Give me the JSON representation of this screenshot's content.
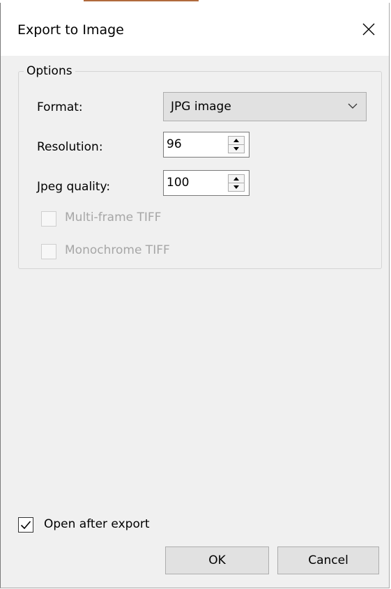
{
  "window": {
    "title": "Export to Image"
  },
  "options": {
    "group_label": "Options",
    "format": {
      "label": "Format:",
      "value": "JPG image"
    },
    "resolution": {
      "label": "Resolution:",
      "value": "96"
    },
    "jpeg_quality": {
      "label": "Jpeg quality:",
      "value": "100"
    },
    "multi_frame_tiff": {
      "label": "Multi-frame TIFF",
      "checked": false,
      "enabled": false
    },
    "monochrome_tiff": {
      "label": "Monochrome TIFF",
      "checked": false,
      "enabled": false
    }
  },
  "open_after_export": {
    "label": "Open after export",
    "checked": true
  },
  "buttons": {
    "ok": "OK",
    "cancel": "Cancel"
  },
  "icons": {
    "close": "close-icon",
    "dropdown": "chevron-down-icon",
    "spin_up": "triangle-up-icon",
    "spin_down": "triangle-down-icon",
    "checkmark": "checkmark-icon"
  }
}
